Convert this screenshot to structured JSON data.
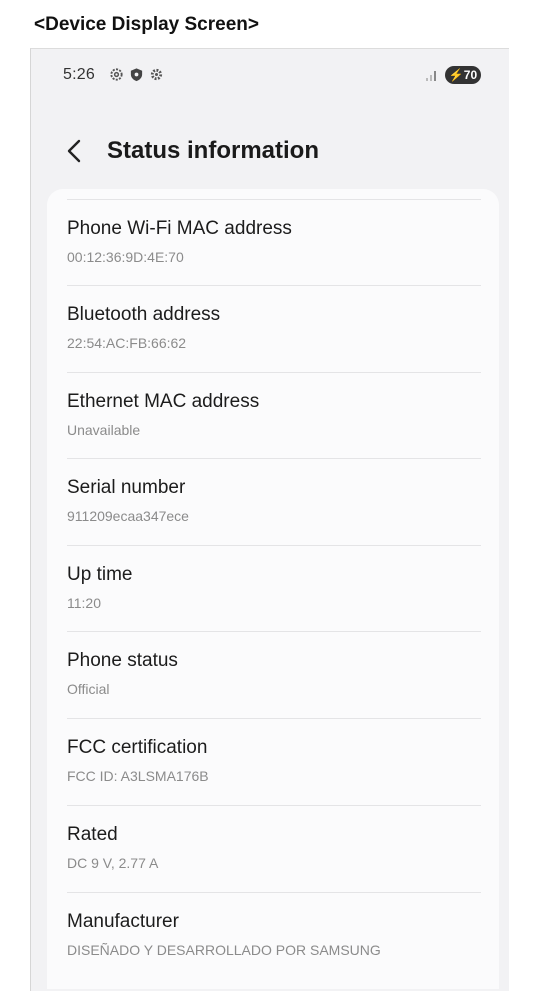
{
  "caption": "<Device Display Screen>",
  "status_bar": {
    "time": "5:26",
    "battery": "70"
  },
  "header": {
    "title": "Status information"
  },
  "items": [
    {
      "label": "Phone Wi-Fi MAC address",
      "value": "00:12:36:9D:4E:70"
    },
    {
      "label": "Bluetooth address",
      "value": "22:54:AC:FB:66:62"
    },
    {
      "label": "Ethernet MAC address",
      "value": "Unavailable"
    },
    {
      "label": "Serial number",
      "value": "911209ecaa347ece"
    },
    {
      "label": "Up time",
      "value": "11:20"
    },
    {
      "label": "Phone status",
      "value": "Official"
    },
    {
      "label": "FCC certification",
      "value": "FCC ID: A3LSMA176B"
    },
    {
      "label": "Rated",
      "value": "DC 9 V, 2.77 A"
    },
    {
      "label": "Manufacturer",
      "value": "DISEÑADO Y DESARROLLADO POR SAMSUNG"
    }
  ]
}
